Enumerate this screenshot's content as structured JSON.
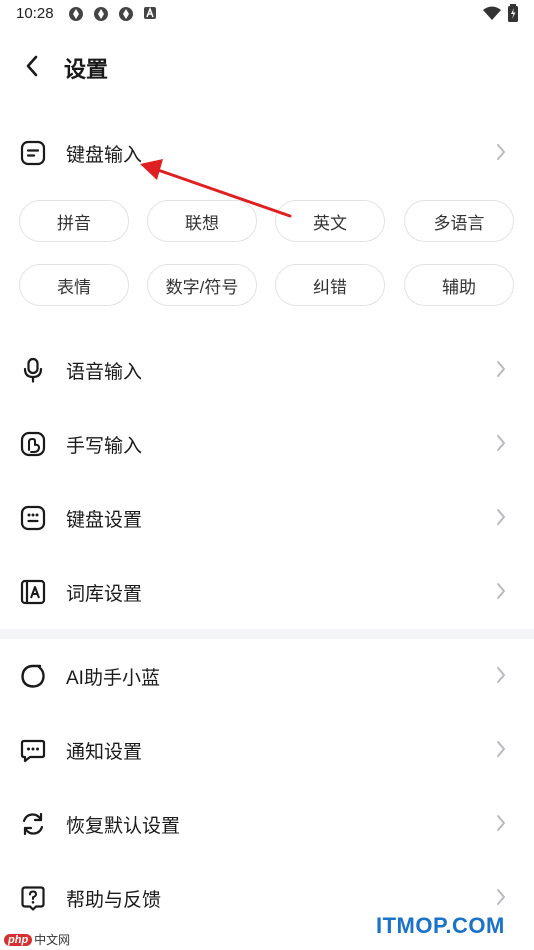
{
  "status_bar": {
    "time": "10:28"
  },
  "header": {
    "title": "设置"
  },
  "keyboard_input": {
    "label": "键盘输入",
    "chips": [
      {
        "label": "拼音"
      },
      {
        "label": "联想"
      },
      {
        "label": "英文"
      },
      {
        "label": "多语言"
      },
      {
        "label": "表情"
      },
      {
        "label": "数字/符号"
      },
      {
        "label": "纠错"
      },
      {
        "label": "辅助"
      }
    ]
  },
  "settings_items": [
    {
      "label": "语音输入",
      "icon": "microphone-icon"
    },
    {
      "label": "手写输入",
      "icon": "handwriting-icon"
    },
    {
      "label": "键盘设置",
      "icon": "keyboard-icon"
    },
    {
      "label": "词库设置",
      "icon": "dictionary-icon"
    }
  ],
  "more_items": [
    {
      "label": "AI助手小蓝",
      "icon": "ai-assistant-icon"
    },
    {
      "label": "通知设置",
      "icon": "notification-icon"
    },
    {
      "label": "恢复默认设置",
      "icon": "restore-icon"
    },
    {
      "label": "帮助与反馈",
      "icon": "help-icon"
    }
  ],
  "watermarks": {
    "right": "ITMOP.COM",
    "left_logo": "php",
    "left_text": "中文网"
  },
  "colors": {
    "annotation_arrow": "#e02020",
    "watermark": "#1a73c8",
    "chip_border": "#e1e3e6"
  }
}
